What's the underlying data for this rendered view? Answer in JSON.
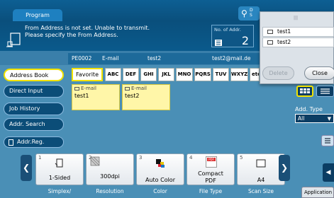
{
  "header": {
    "program_tab": "Program",
    "search_label_lines": [
      "D",
      "S"
    ]
  },
  "message": {
    "line1": "From Address is not set. Unable to transmit.",
    "line2": "Please specify the From Address.",
    "addr_count_label": "No. of Addr.",
    "addr_count": "2"
  },
  "destination": {
    "id": "PE0002",
    "type": "E-mail",
    "name": "test2",
    "address": "test2@mail.de"
  },
  "sidebar": {
    "items": [
      {
        "label": "Address Book"
      },
      {
        "label": "Direct Input"
      },
      {
        "label": "Job History"
      },
      {
        "label": "Addr. Search"
      }
    ],
    "addr_reg": "Addr.Reg."
  },
  "index_tabs": [
    "Favorite",
    "ABC",
    "DEF",
    "GHI",
    "JKL",
    "MNO",
    "PQRS",
    "TUV",
    "WXYZ",
    "etc"
  ],
  "entries": [
    {
      "type": "E-mail",
      "name": "test1"
    },
    {
      "type": "E-mail",
      "name": "test2"
    }
  ],
  "popup": {
    "items": [
      "test1",
      "test2"
    ],
    "delete_label": "Delete",
    "close_label": "Close"
  },
  "add_type": {
    "label": "Add. Type",
    "value": "All"
  },
  "settings": [
    {
      "num": "1",
      "value": "1-Sided",
      "caption": "Simplex/"
    },
    {
      "num": "2",
      "value": "300dpi",
      "caption": "Resolution"
    },
    {
      "num": "3",
      "value": "Auto Color",
      "caption": "Color"
    },
    {
      "num": "4",
      "value_line1": "Compact",
      "value_line2": "PDF",
      "caption": "File Type",
      "icon_text": "PDF"
    },
    {
      "num": "5",
      "value": "A4",
      "caption": "Scan Size"
    }
  ],
  "application_tab": "Application",
  "colors": {
    "accent": "#f2e200",
    "entry_bg": "#fff6a8",
    "header_bg": "#0a4f7c"
  }
}
